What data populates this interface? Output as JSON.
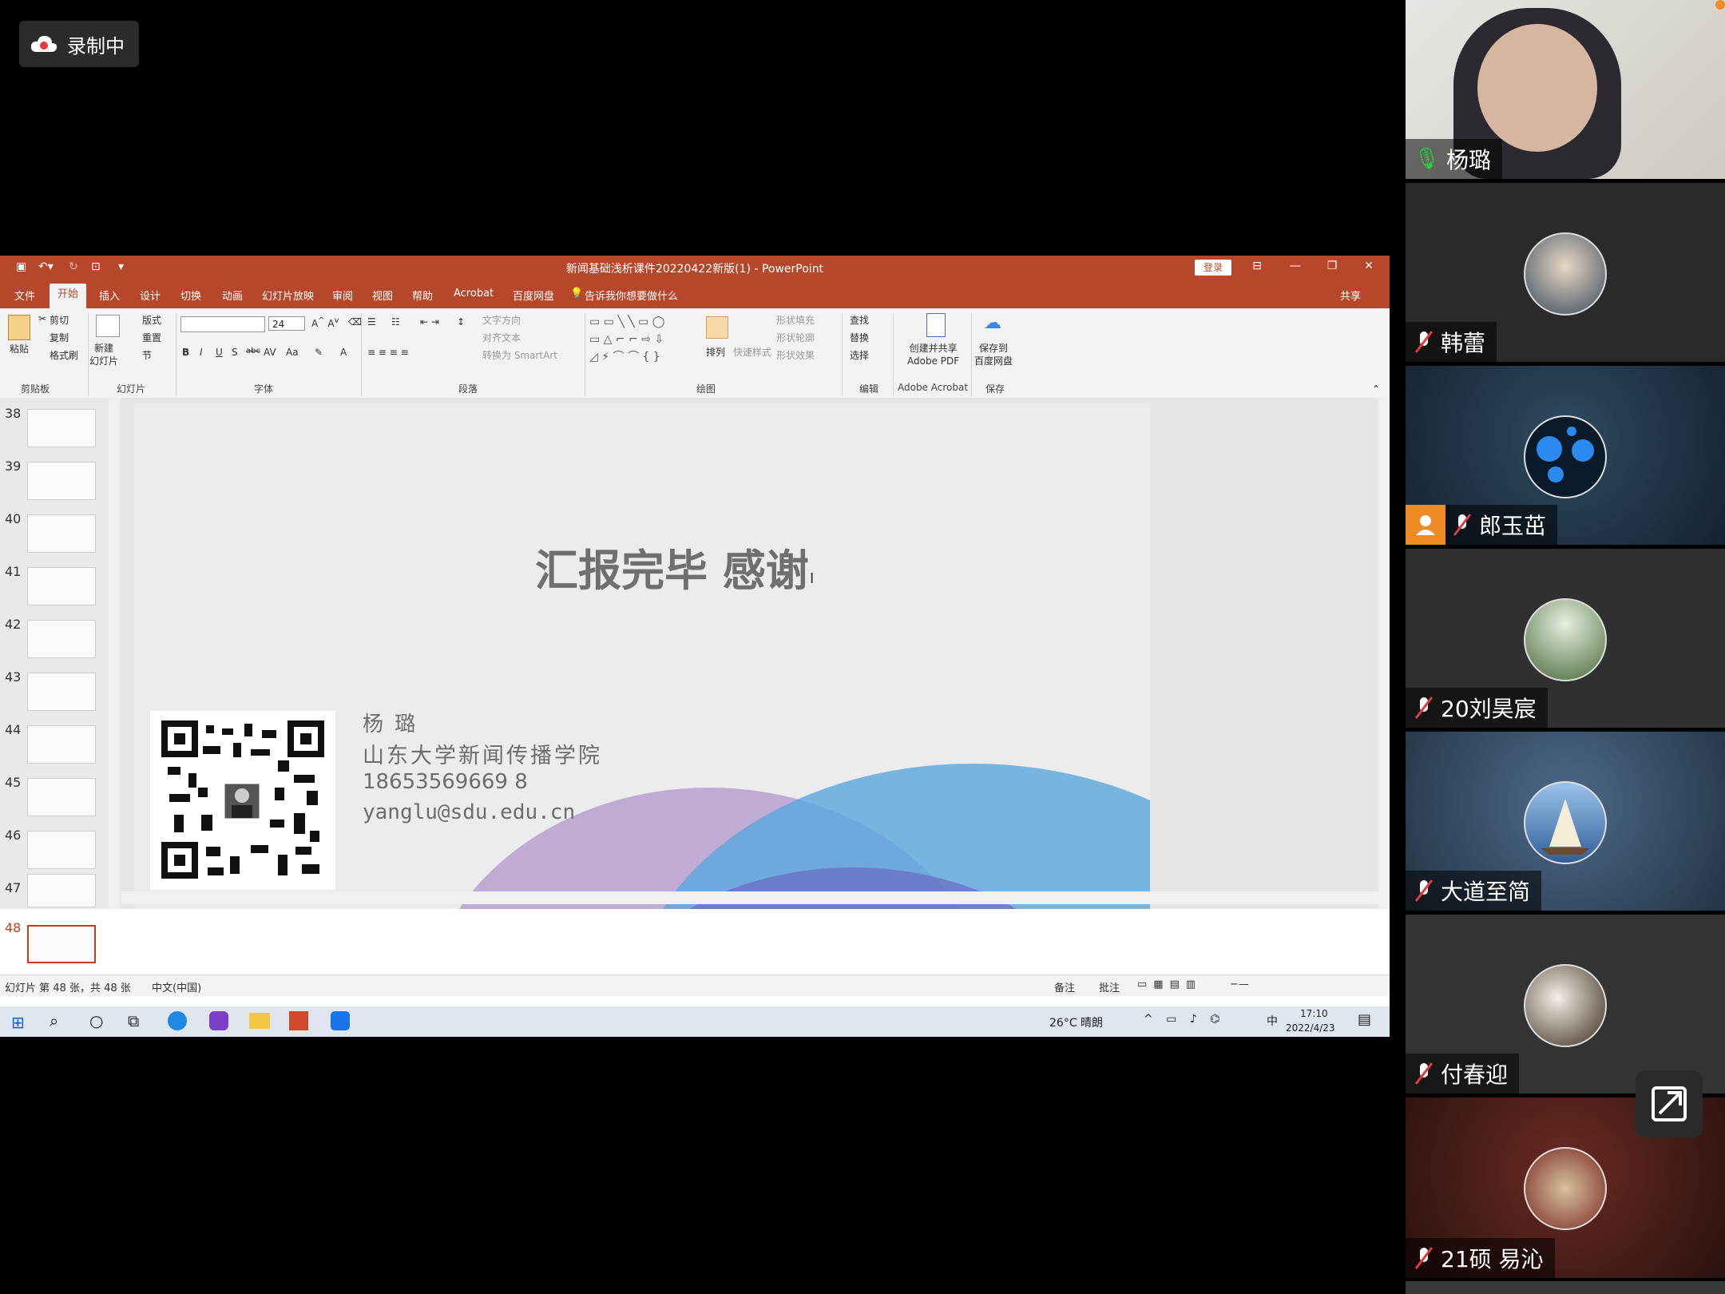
{
  "recording": {
    "label": "录制中"
  },
  "ppt": {
    "window_title": "新闻基础浅析课件20220422新版(1)  -  PowerPoint",
    "login_label": "登录",
    "share_label": "共享",
    "tabs": [
      "文件",
      "开始",
      "插入",
      "设计",
      "切换",
      "动画",
      "幻灯片放映",
      "审阅",
      "视图",
      "帮助",
      "Acrobat",
      "百度网盘"
    ],
    "active_tab": "开始",
    "tell_me": "告诉我你想要做什么",
    "ribbon": {
      "paste": "粘贴",
      "cut": "剪切",
      "copy": "复制",
      "format_painter": "格式刷",
      "new_slide": "新建\n幻灯片",
      "layout": "版式",
      "reset": "重置",
      "section": "节",
      "font_size": "24",
      "text_direction": "文字方向",
      "align_text": "对齐文本",
      "smartart": "转换为 SmartArt",
      "arrange": "排列",
      "quick_styles": "快速样式",
      "shape_fill": "形状填充",
      "shape_outline": "形状轮廓",
      "shape_effects": "形状效果",
      "find": "查找",
      "replace": "替换",
      "select": "选择",
      "acrobat_btn": "创建并共享\nAdobe PDF",
      "baidu_btn": "保存到\n百度网盘",
      "groups": [
        "剪贴板",
        "幻灯片",
        "字体",
        "段落",
        "绘图",
        "编辑",
        "Adobe Acrobat",
        "保存"
      ]
    },
    "thumbnails": [
      "38",
      "39",
      "40",
      "41",
      "42",
      "43",
      "44",
      "45",
      "46",
      "47",
      "48"
    ],
    "slide": {
      "title": "汇报完毕  感谢",
      "name": "杨  璐",
      "school": "山东大学新闻传播学院",
      "phone": "18653569669 8",
      "email": "yanglu@sdu.edu.cn"
    },
    "status": {
      "slide_info": "幻灯片 第 48 张，共 48 张",
      "language": "中文(中国)",
      "notes": "备注",
      "comments": "批注"
    },
    "taskbar": {
      "weather": "26°C  晴朗",
      "ime": "中",
      "time": "17:10",
      "date": "2022/4/23"
    }
  },
  "participants": [
    {
      "name": "杨璐",
      "muted": false
    },
    {
      "name": "韩蕾",
      "muted": true
    },
    {
      "name": "郎玉茁",
      "muted": true
    },
    {
      "name": "20刘昊宸",
      "muted": true
    },
    {
      "name": "大道至简",
      "muted": true
    },
    {
      "name": "付春迎",
      "muted": true
    },
    {
      "name": "21硕 易沁",
      "muted": true
    }
  ],
  "colors": {
    "ppt_accent": "#b7472a",
    "rec_icon": "#e63a3a",
    "mic_on": "#2ecc40",
    "mic_off": "#e23b3b"
  }
}
